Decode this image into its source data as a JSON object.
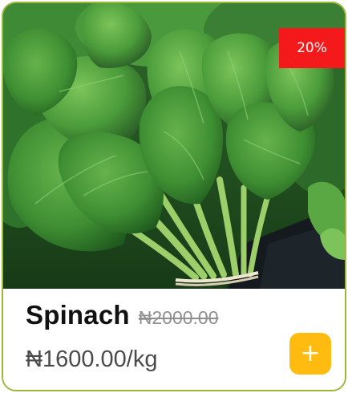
{
  "product": {
    "name": "Spinach",
    "old_price": "₦2000.00",
    "price": "₦1600.00/kg",
    "discount_badge": "20%",
    "add_icon": "plus-icon",
    "image_icon": "spinach-photo"
  },
  "colors": {
    "card_border": "#9bb83a",
    "badge_bg": "#f4191a",
    "add_button_bg": "#ffbb0f",
    "price_text": "#4a4a4a",
    "old_price_text": "#8f8f8f"
  }
}
